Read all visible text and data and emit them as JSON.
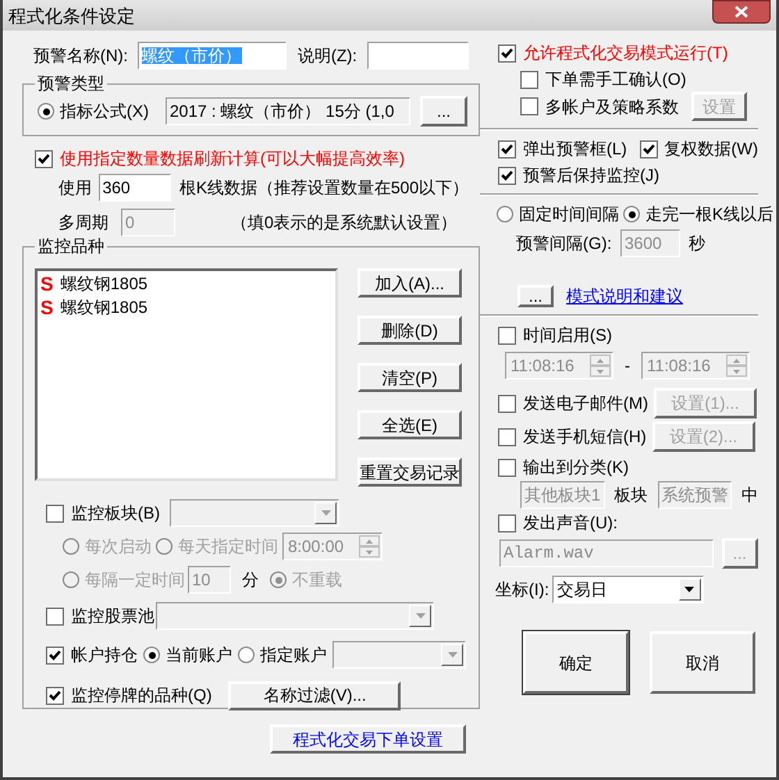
{
  "window": {
    "title": "程式化条件设定"
  },
  "alert_name": {
    "label": "预警名称(N):",
    "value": "螺纹（市价）",
    "highlighted": true
  },
  "description": {
    "label": "说明(Z):"
  },
  "alert_type": {
    "title": "预警类型",
    "options": [
      {
        "label": "指标公式(X)",
        "selected": true
      }
    ],
    "formula": "2017 : 螺纹（市价） 15分 (1,0",
    "browse_button": "..."
  },
  "refresh": {
    "label": "使用指定数量数据刷新计算(可以大幅提高效率)",
    "checked": true,
    "warning": true
  },
  "bars": {
    "label": "使用",
    "value": "360",
    "note": "根K线数据（推荐设置数量在500以下）"
  },
  "multi_period": {
    "label": "多周期",
    "value": "0",
    "disabled": true,
    "note": "（填0表示的是系统默认设置）"
  },
  "monitor": {
    "title": "监控品种",
    "items": [
      {
        "marker": "S",
        "name": "螺纹钢1805"
      },
      {
        "marker": "S",
        "name": "螺纹钢1805"
      }
    ],
    "buttons": [
      "加入(A)...",
      "删除(D)",
      "清空(P)",
      "全选(E)",
      "重置交易记录"
    ],
    "sector": {
      "label": "监控板块(B)",
      "checked": false
    },
    "reload": {
      "options": [
        {
          "label": "每次启动",
          "selected": false
        },
        {
          "label": "每天指定时间",
          "selected": false
        },
        {
          "label": "每隔一定时间",
          "selected": false
        },
        {
          "label": "不重载",
          "selected": true
        }
      ],
      "daily_time": "8:00:00",
      "interval": "10",
      "interval_unit": "分"
    },
    "stock_pool": {
      "label": "监控股票池",
      "checked": false
    },
    "positions": {
      "label": "帐户持仓",
      "checked": true,
      "accounts": [
        {
          "label": "当前账户",
          "selected": true
        },
        {
          "label": "指定账户",
          "selected": false
        }
      ]
    },
    "suspended": {
      "label": "监控停牌的品种(Q)",
      "checked": true
    },
    "filter_button": "名称过滤(V)..."
  },
  "order_settings_button": "程式化交易下单设置",
  "trading": {
    "label": "允许程式化交易模式运行(T)",
    "checked": true,
    "warning": true
  },
  "manual_confirm": {
    "label": "下单需手工确认(O)",
    "checked": false
  },
  "multi_account": {
    "label": "多帐户及策略系数",
    "checked": false,
    "button": "设置"
  },
  "popup": {
    "label": "弹出预警框(L)",
    "checked": true
  },
  "adjusted": {
    "label": "复权数据(W)",
    "checked": true
  },
  "keep_monitoring": {
    "label": "预警后保持监控(J)",
    "checked": true
  },
  "interval_mode": [
    {
      "label": "固定时间间隔",
      "selected": false
    },
    {
      "label": "走完一根K线以后",
      "selected": true
    }
  ],
  "alert_interval": {
    "label": "预警间隔(G):",
    "value": "3600",
    "unit": "秒"
  },
  "mode_button": "...",
  "mode_link": "模式说明和建议",
  "time_enabled": {
    "label": "时间启用(S)",
    "checked": false,
    "start": "11:08:16",
    "separator": "-",
    "end": "11:08:16"
  },
  "email": {
    "label": "发送电子邮件(M)",
    "checked": false,
    "button": "设置(1)..."
  },
  "sms": {
    "label": "发送手机短信(H)",
    "checked": false,
    "button": "设置(2)..."
  },
  "output": {
    "label": "输出到分类(K)",
    "checked": false,
    "category": "其他板块1",
    "category_label": "板块",
    "target": "系统预警",
    "suffix": "中"
  },
  "sound": {
    "label": "发出声音(U):",
    "checked": false,
    "file": "Alarm.wav",
    "browse_button": "..."
  },
  "axis": {
    "label": "坐标(I):",
    "value": "交易日"
  },
  "buttons": [
    "确定",
    "取消"
  ]
}
